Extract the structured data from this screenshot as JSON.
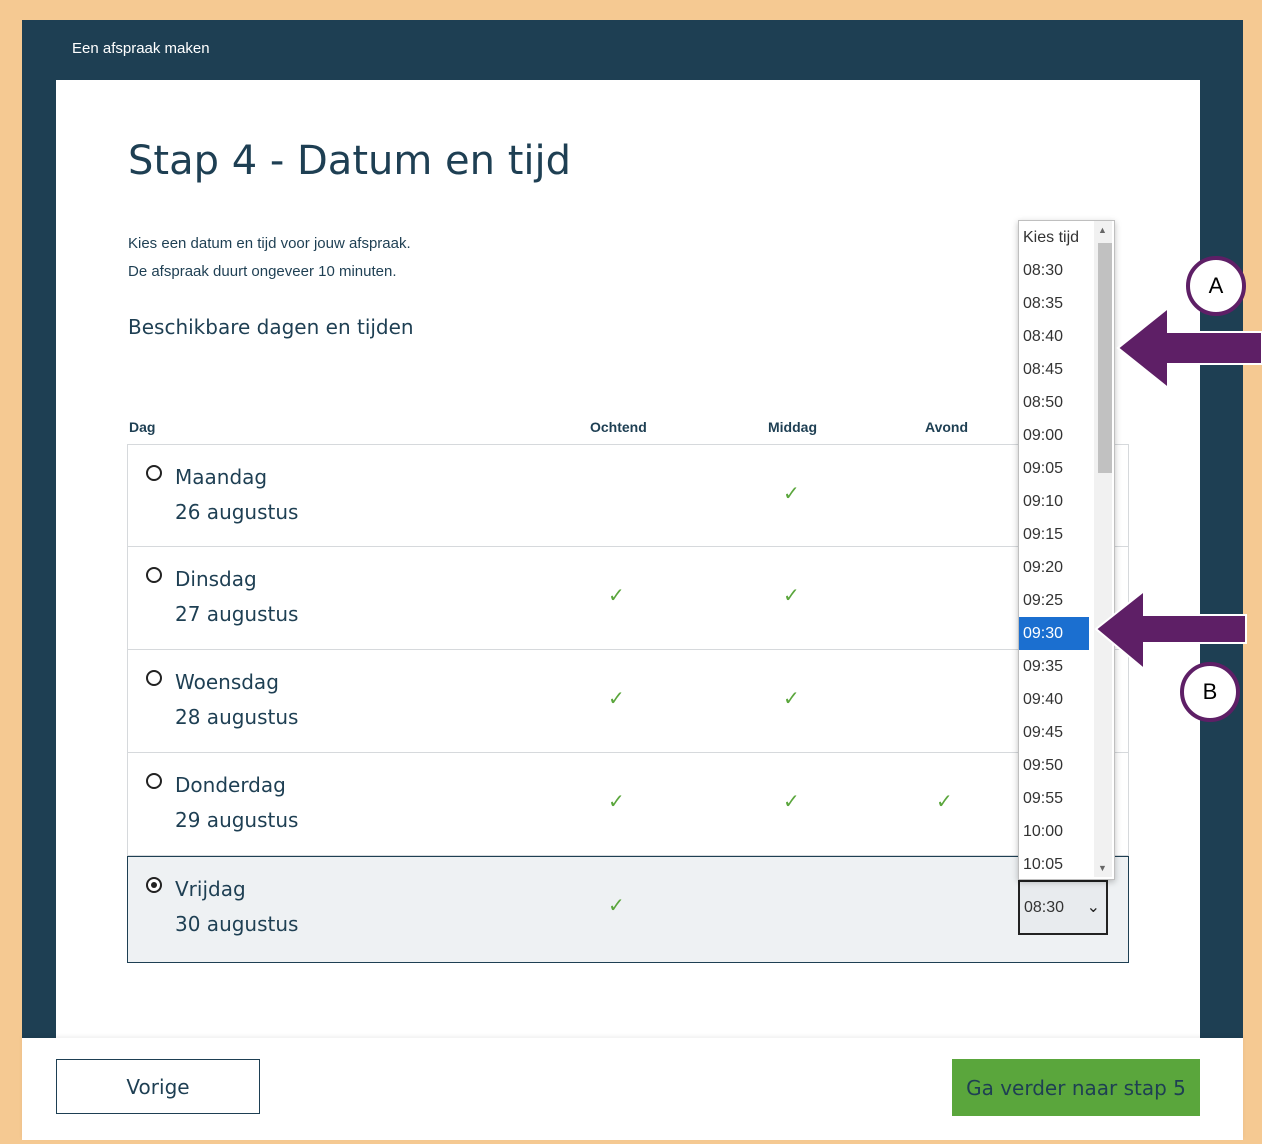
{
  "header": {
    "title": "Een afspraak maken"
  },
  "page": {
    "title": "Stap 4 - Datum en tijd",
    "intro_line1": "Kies een datum en tijd voor jouw afspraak.",
    "intro_line2": "De afspraak duurt ongeveer 10 minuten.",
    "available_heading": "Beschikbare dagen en tijden"
  },
  "table": {
    "headers": {
      "day": "Dag",
      "morning": "Ochtend",
      "afternoon": "Middag",
      "evening": "Avond"
    },
    "rows": [
      {
        "day": "Maandag",
        "date": "26 augustus",
        "morning": false,
        "afternoon": true,
        "evening": false,
        "selected": false
      },
      {
        "day": "Dinsdag",
        "date": "27 augustus",
        "morning": true,
        "afternoon": true,
        "evening": false,
        "selected": false
      },
      {
        "day": "Woensdag",
        "date": "28 augustus",
        "morning": true,
        "afternoon": true,
        "evening": false,
        "selected": false
      },
      {
        "day": "Donderdag",
        "date": "29 augustus",
        "morning": true,
        "afternoon": true,
        "evening": true,
        "selected": false
      },
      {
        "day": "Vrijdag",
        "date": "30 augustus",
        "morning": true,
        "afternoon": false,
        "evening": false,
        "selected": true
      }
    ]
  },
  "time_select": {
    "current_value": "08:30",
    "options": [
      "Kies tijd",
      "08:30",
      "08:35",
      "08:40",
      "08:45",
      "08:50",
      "09:00",
      "09:05",
      "09:10",
      "09:15",
      "09:20",
      "09:25",
      "09:30",
      "09:35",
      "09:40",
      "09:45",
      "09:50",
      "09:55",
      "10:00",
      "10:05"
    ],
    "highlighted": "09:30"
  },
  "annotations": {
    "a": "A",
    "b": "B",
    "arrow_color": "#5e1f66"
  },
  "footer": {
    "prev_label": "Vorige",
    "next_label": "Ga verder naar stap 5"
  },
  "colors": {
    "frame": "#1e3f53",
    "accent_green": "#5aa63c",
    "highlight_blue": "#1b6fd0",
    "border_outer": "#f5c992"
  }
}
